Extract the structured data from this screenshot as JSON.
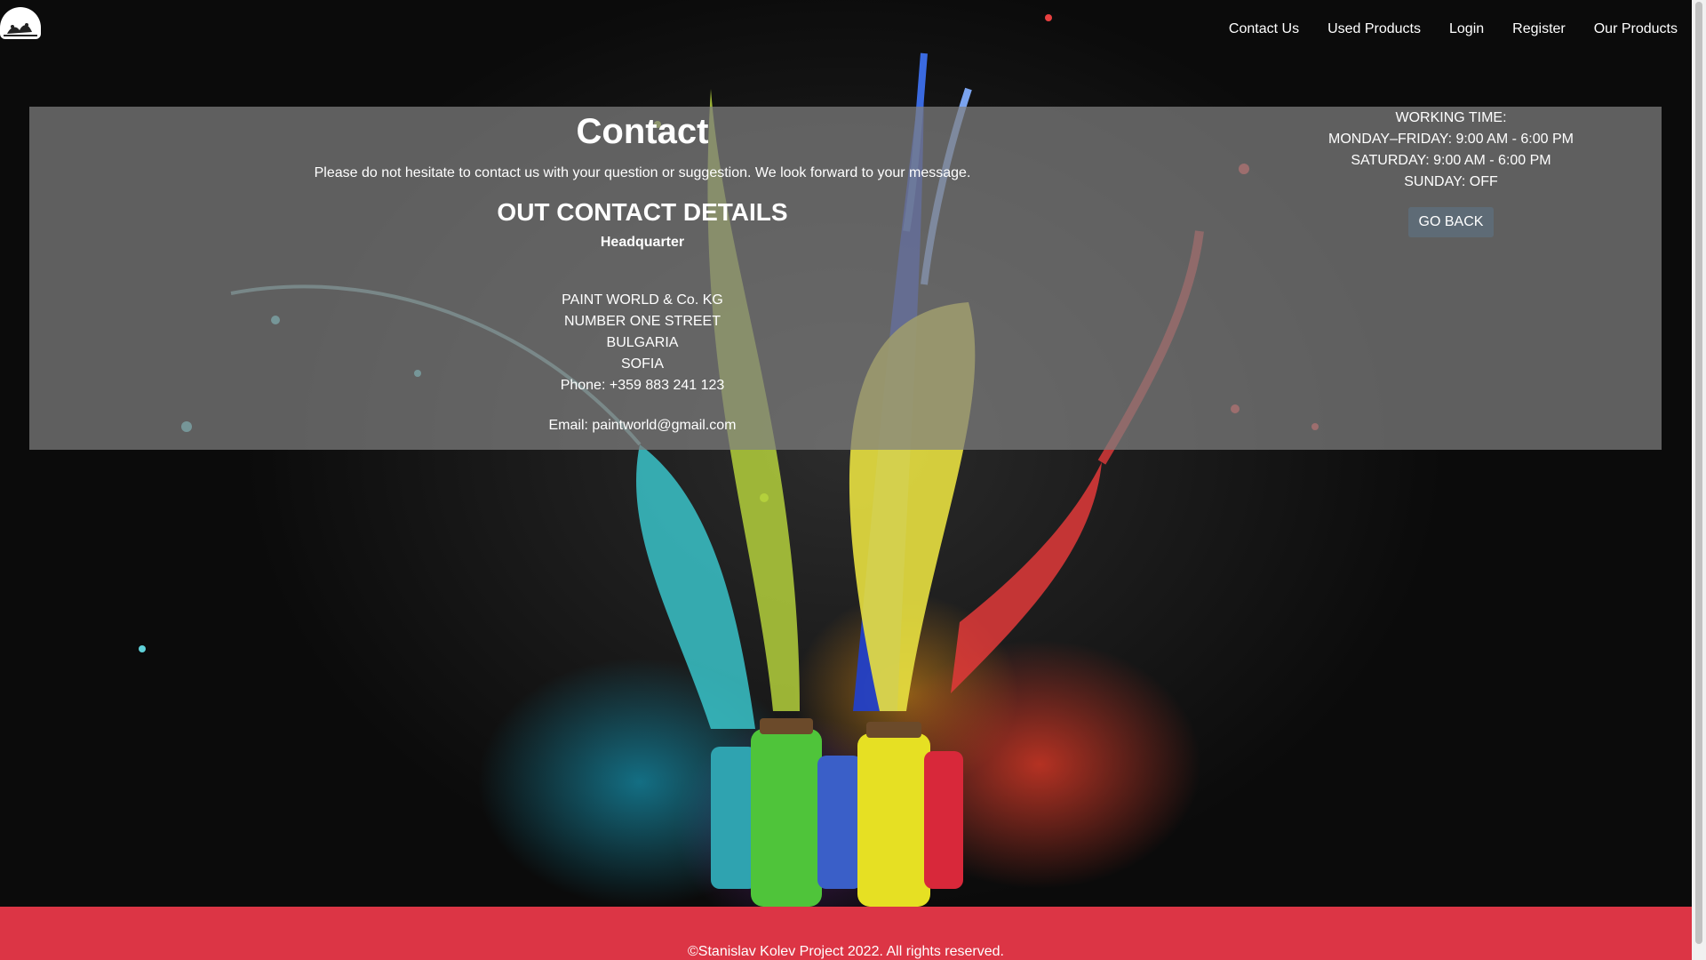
{
  "nav": {
    "items": [
      "Contact Us",
      "Used Products",
      "Login",
      "Register",
      "Our Products"
    ]
  },
  "contact": {
    "title": "Contact",
    "intro": "Please do not hesitate to contact us with your question or suggestion. We look forward to your message.",
    "details_title": "OUT CONTACT DETAILS",
    "hq_label": "Headquarter",
    "company": "PAINT WORLD & Co. KG",
    "street": "NUMBER ONE STREET",
    "country": "BULGARIA",
    "city": "SOFIA",
    "phone": "Phone: +359 883 241 123",
    "email": "Email: paintworld@gmail.com"
  },
  "hours": {
    "heading": "WORKING TIME:",
    "weekdays": "MONDAY–FRIDAY: 9:00 AM - 6:00 PM",
    "saturday": "SATURDAY: 9:00 AM - 6:00 PM",
    "sunday": "SUNDAY: OFF",
    "back_label": "GO BACK"
  },
  "footer": {
    "text": "©Stanislav Kolev Project 2022. All rights reserved."
  },
  "colors": {
    "footer_bg": "#dc3545",
    "panel_bg": "rgba(128,128,128,0.72)",
    "button_bg": "#5e6b76"
  },
  "icons": {
    "logo": "paint-splash-logo-icon"
  }
}
